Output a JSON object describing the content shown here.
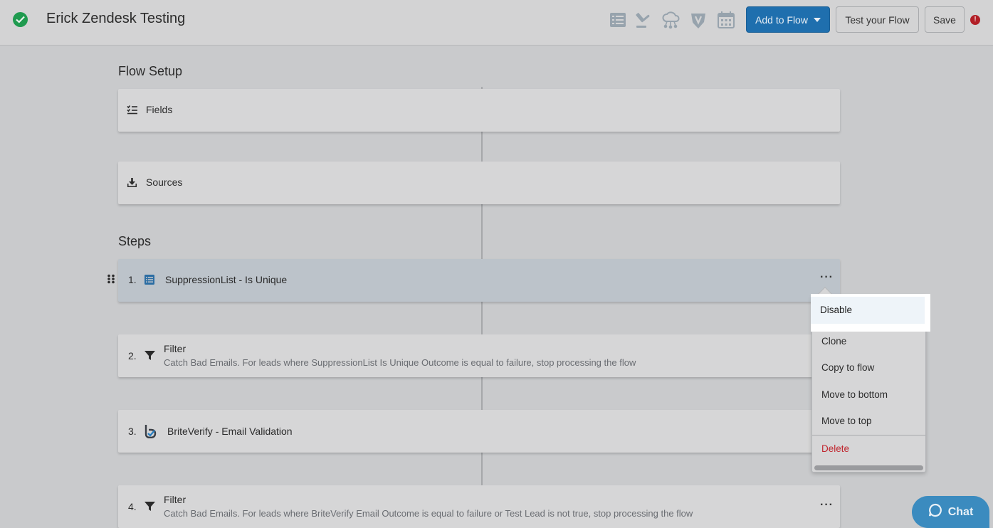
{
  "header": {
    "title": "Erick Zendesk Testing",
    "add_to_flow": "Add to Flow",
    "test_flow": "Test your Flow",
    "save": "Save",
    "error_badge": "!",
    "icons": [
      "list-icon",
      "gavel-icon",
      "cloud-network-icon",
      "verify-shield-icon",
      "calendar-icon"
    ]
  },
  "flow_setup": {
    "title": "Flow Setup",
    "fields": "Fields",
    "sources": "Sources"
  },
  "steps": {
    "title": "Steps",
    "items": [
      {
        "num": "1.",
        "label": "SuppressionList - Is Unique",
        "icon": "list-icon"
      },
      {
        "num": "2.",
        "label": "Filter",
        "sub": "Catch Bad Emails. For leads where SuppressionList Is Unique Outcome is equal to failure, stop processing the flow",
        "icon": "filter-icon"
      },
      {
        "num": "3.",
        "label": "BriteVerify - Email Validation",
        "icon": "briteverify-icon"
      },
      {
        "num": "4.",
        "label": "Filter",
        "sub": "Catch Bad Emails. For leads where BriteVerify Email Outcome is equal to failure or Test Lead is not true, stop processing the flow",
        "icon": "filter-icon"
      }
    ]
  },
  "menu": {
    "items": [
      "Disable",
      "Clone",
      "Copy to flow",
      "Move to bottom",
      "Move to top",
      "Delete"
    ]
  },
  "chat": {
    "label": "Chat"
  },
  "colors": {
    "accent": "#1f6fae",
    "danger": "#c0262e",
    "success": "#1f9a4f"
  }
}
